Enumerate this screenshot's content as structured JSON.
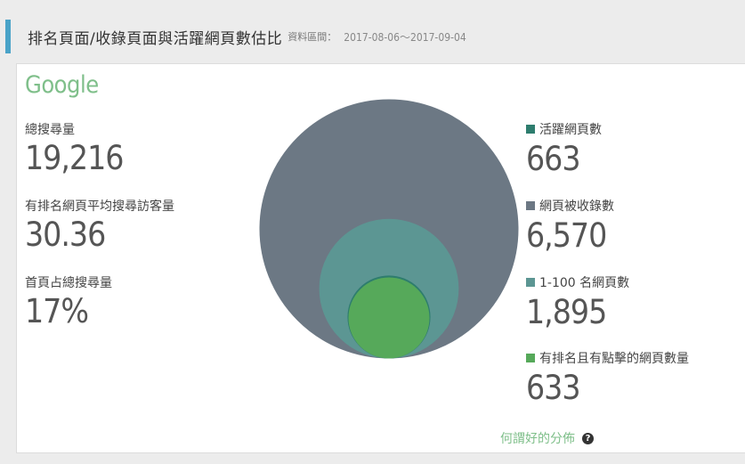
{
  "header": {
    "title": "排名頁面/收錄頁面與活躍網頁數估比",
    "range_label": "資料區間：",
    "range_value": "2017-08-06～2017-09-04"
  },
  "panel": {
    "brand": "Google",
    "stats": [
      {
        "label": "總搜尋量",
        "value": "19,216"
      },
      {
        "label": "有排名網頁平均搜尋訪客量",
        "value": "30.36"
      },
      {
        "label": "首頁占總搜尋量",
        "value": "17%"
      }
    ],
    "help_link": "何謂好的分佈",
    "help_icon": "question-icon"
  },
  "chart_data": {
    "type": "nested-circles",
    "series": [
      {
        "name": "活躍網頁數",
        "value": 663,
        "display": "663",
        "color": "#2e7d6e"
      },
      {
        "name": "網頁被收錄數",
        "value": 6570,
        "display": "6,570",
        "color": "#6c7884"
      },
      {
        "name": "1-100 名網頁數",
        "value": 1895,
        "display": "1,895",
        "color": "#5c9693"
      },
      {
        "name": "有排名且有點擊的網頁數量",
        "value": 633,
        "display": "633",
        "color": "#56a95a"
      }
    ]
  }
}
